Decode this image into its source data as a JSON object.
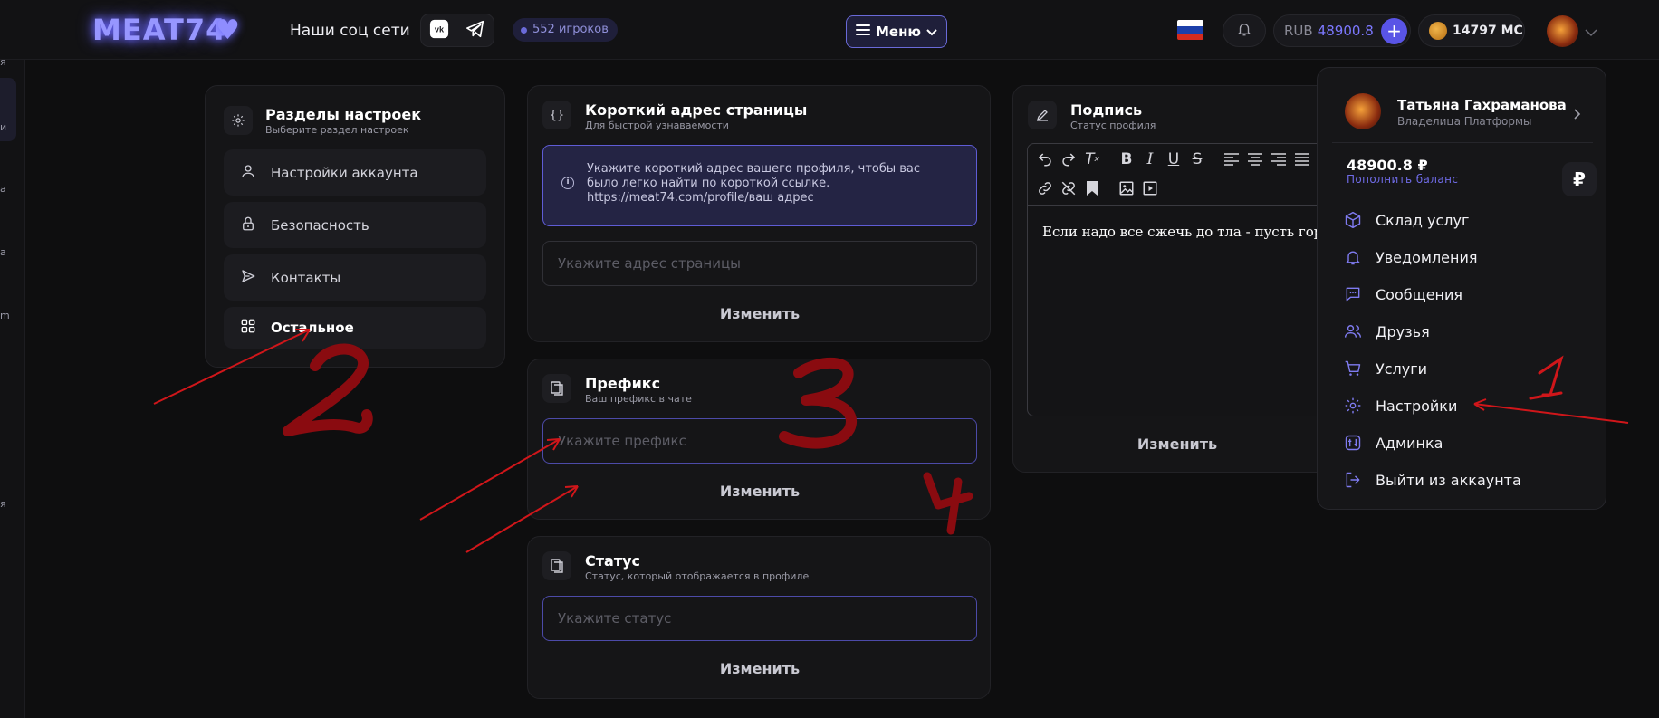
{
  "header": {
    "logo": "MEAT74",
    "social_label": "Наши соц сети",
    "vk_icon": "vk-icon",
    "telegram_icon": "telegram-icon",
    "players": "552 игроков",
    "menu_label": "Меню",
    "balance_currency": "RUB",
    "balance_amount": "48900.8",
    "coins": "14797 MC",
    "flag_colors": [
      "#ffffff",
      "#1c3faa",
      "#d52b1e"
    ],
    "accent": "#5954e6"
  },
  "left_strip": [
    "я",
    "и",
    "а",
    "а",
    "m",
    "я"
  ],
  "settings_sections": {
    "title": "Разделы настроек",
    "subtitle": "Выберите раздел настроек",
    "items": [
      {
        "label": "Настройки аккаунта",
        "icon": "user-icon"
      },
      {
        "label": "Безопасность",
        "icon": "lock-icon"
      },
      {
        "label": "Контакты",
        "icon": "send-icon"
      },
      {
        "label": "Остальное",
        "icon": "grid-icon",
        "active": true
      }
    ]
  },
  "short_address": {
    "title": "Короткий адрес страницы",
    "subtitle": "Для быстрой узнаваемости",
    "info_line1": "Укажите короткий адрес вашего профиля, чтобы вас",
    "info_line2": "было легко найти по короткой ссылке.",
    "info_line3": "https://meat74.com/profile/ваш адрес",
    "placeholder": "Укажите адрес страницы",
    "button": "Изменить"
  },
  "prefix": {
    "title": "Префикс",
    "subtitle": "Ваш префикс в чате",
    "placeholder": "Укажите префикс",
    "button": "Изменить"
  },
  "status": {
    "title": "Статус",
    "subtitle": "Статус, который отображается в профиле",
    "placeholder": "Укажите статус",
    "button": "Изменить"
  },
  "signature": {
    "title": "Подпись",
    "subtitle": "Статус профиля",
    "text": "Если надо все сжечь до тла - пусть горит!",
    "button": "Изменить"
  },
  "dropdown": {
    "name": "Татьяна Гахраманова",
    "role": "Владелица Платформы",
    "balance": "48900.8 ₽",
    "topup": "Пополнить баланс",
    "rub_symbol": "₽",
    "items": [
      {
        "label": "Склад услуг",
        "icon": "box-icon"
      },
      {
        "label": "Уведомления",
        "icon": "bell-icon"
      },
      {
        "label": "Сообщения",
        "icon": "chat-icon"
      },
      {
        "label": "Друзья",
        "icon": "users-icon"
      },
      {
        "label": "Услуги",
        "icon": "cart-icon"
      },
      {
        "label": "Настройки",
        "icon": "gear-icon"
      },
      {
        "label": "Админка",
        "icon": "admin-icon"
      },
      {
        "label": "Выйти из аккаунта",
        "icon": "logout-icon"
      }
    ]
  },
  "annotations": {
    "color": "#d0161a",
    "numbers": [
      "1",
      "2",
      "3",
      "4"
    ]
  }
}
